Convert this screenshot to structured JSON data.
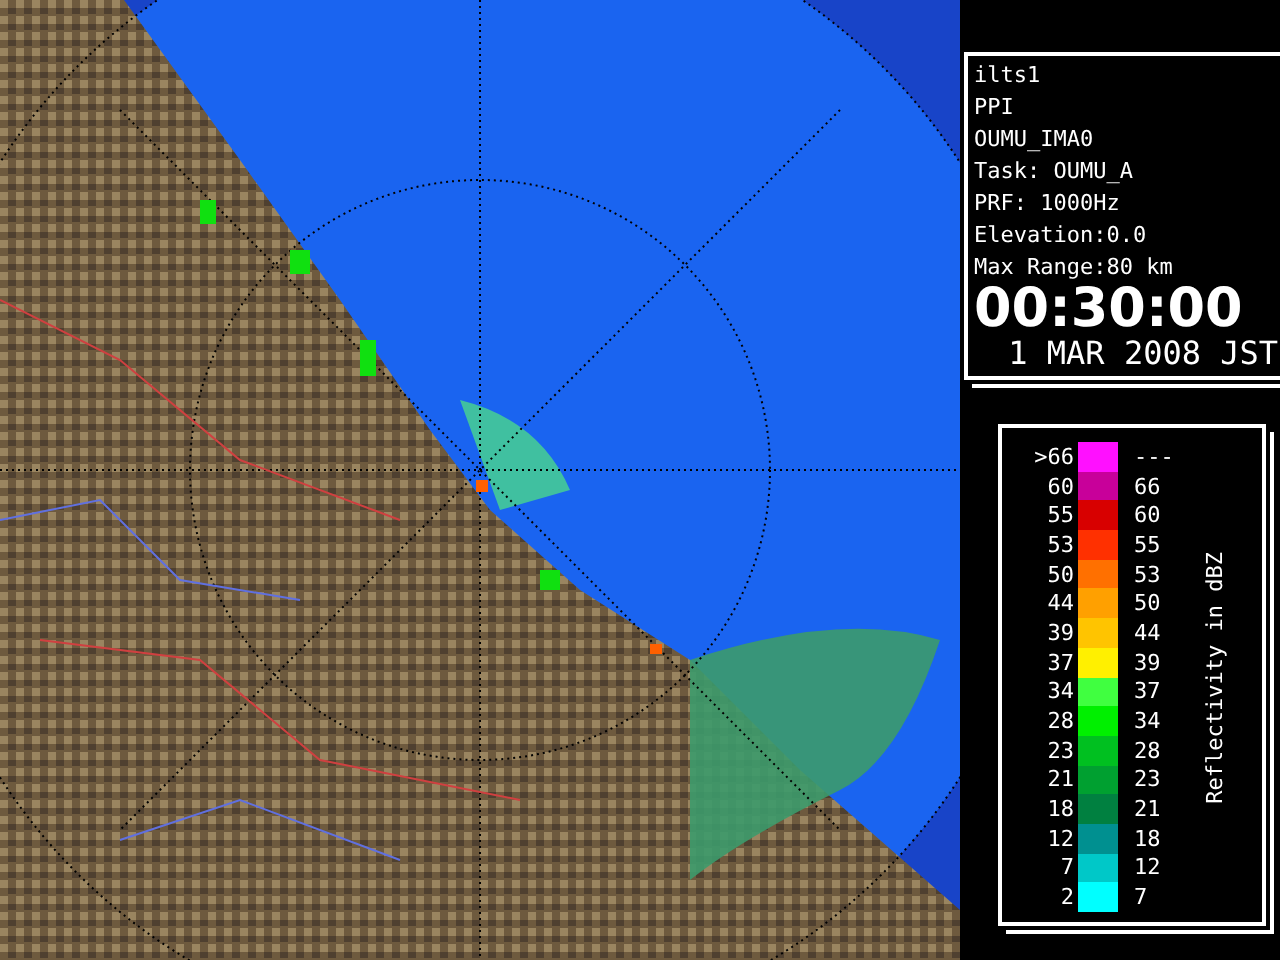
{
  "info": {
    "lines": [
      "ilts1",
      "PPI",
      "OUMU_IMA0",
      "Task: OUMU_A",
      "PRF: 1000Hz",
      "Elevation:0.0",
      "Max Range:80 km"
    ],
    "time": "00:30:00",
    "date": "1 MAR 2008 JST"
  },
  "legend": {
    "title": "Reflectivity in dBZ",
    "rows": [
      {
        "low": ">66",
        "high": "---",
        "color": "#ff10ff"
      },
      {
        "low": "60",
        "high": "66",
        "color": "#c8009a"
      },
      {
        "low": "55",
        "high": "60",
        "color": "#d80000"
      },
      {
        "low": "53",
        "high": "55",
        "color": "#ff3000"
      },
      {
        "low": "50",
        "high": "53",
        "color": "#ff7000"
      },
      {
        "low": "44",
        "high": "50",
        "color": "#ffa000"
      },
      {
        "low": "39",
        "high": "44",
        "color": "#ffc400"
      },
      {
        "low": "37",
        "high": "39",
        "color": "#fff000"
      },
      {
        "low": "34",
        "high": "37",
        "color": "#40ff40"
      },
      {
        "low": "28",
        "high": "34",
        "color": "#00f000"
      },
      {
        "low": "23",
        "high": "28",
        "color": "#00c020"
      },
      {
        "low": "21",
        "high": "23",
        "color": "#00a030"
      },
      {
        "low": "18",
        "high": "21",
        "color": "#008040"
      },
      {
        "low": "12",
        "high": "18",
        "color": "#009090"
      },
      {
        "low": "7",
        "high": "12",
        "color": "#00c8c8"
      },
      {
        "low": "2",
        "high": "7",
        "color": "#00ffff"
      }
    ]
  }
}
